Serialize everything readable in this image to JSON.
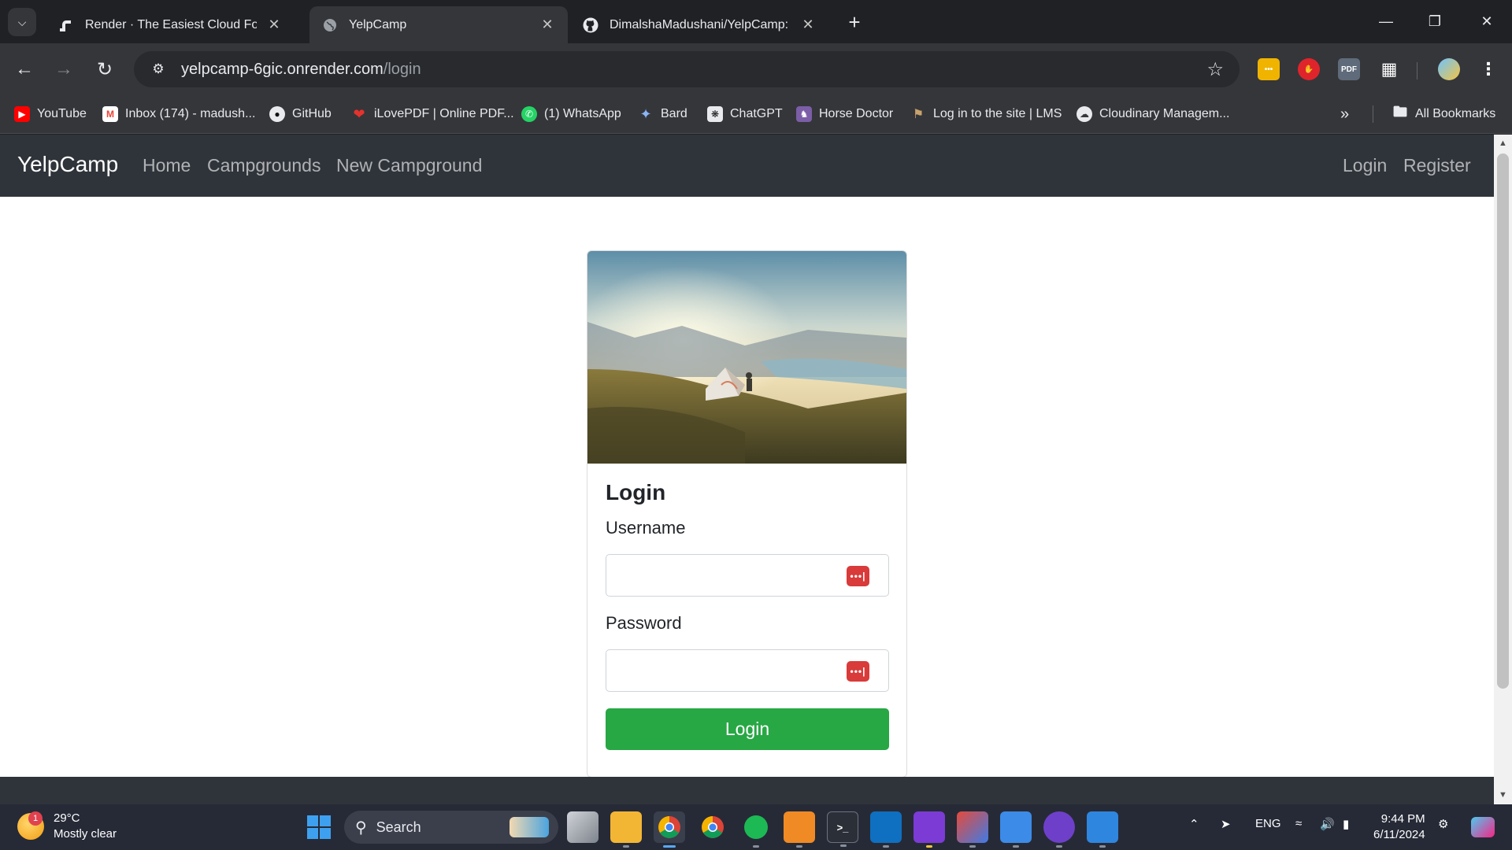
{
  "browser": {
    "tabs": [
      {
        "title": "Render · The Easiest Cloud For All Your Apps",
        "active": false
      },
      {
        "title": "YelpCamp",
        "active": true
      },
      {
        "title": "DimalshaMadushani/YelpCamp: A",
        "active": false
      }
    ],
    "url_host": "yelpcamp-6gic.onrender.com",
    "url_path": "/login",
    "bookmarks": [
      {
        "label": "YouTube",
        "icon": "youtube-icon"
      },
      {
        "label": "Inbox (174) - madush...",
        "icon": "gmail-icon"
      },
      {
        "label": "GitHub",
        "icon": "github-icon"
      },
      {
        "label": "iLovePDF | Online PDF...",
        "icon": "ilovepdf-icon"
      },
      {
        "label": "(1) WhatsApp",
        "icon": "whatsapp-icon"
      },
      {
        "label": "Bard",
        "icon": "bard-icon"
      },
      {
        "label": "ChatGPT",
        "icon": "chatgpt-icon"
      },
      {
        "label": "Horse Doctor",
        "icon": "horse-doctor-icon"
      },
      {
        "label": "Log in to the site | LMS",
        "icon": "lms-icon"
      },
      {
        "label": "Cloudinary Managem...",
        "icon": "cloudinary-icon"
      }
    ],
    "all_bookmarks": "All Bookmarks",
    "ext_pdf": "PDF"
  },
  "site": {
    "brand": "YelpCamp",
    "nav": [
      "Home",
      "Campgrounds",
      "New Campground"
    ],
    "auth": [
      "Login",
      "Register"
    ]
  },
  "login_form": {
    "title": "Login",
    "username_label": "Username",
    "password_label": "Password",
    "submit": "Login",
    "pw_icon": "•••|"
  },
  "taskbar": {
    "weather_temp": "29°C",
    "weather_desc": "Mostly clear",
    "weather_badge": "1",
    "search": "Search",
    "lang": "ENG",
    "time": "9:44 PM",
    "date": "6/11/2024"
  },
  "colors": {
    "navbar": "#2f343a",
    "login_button": "#28a745",
    "password_manager_icon": "#d93a3a"
  }
}
